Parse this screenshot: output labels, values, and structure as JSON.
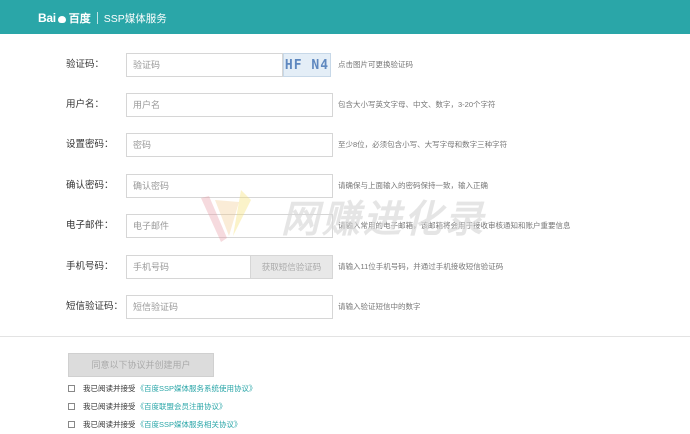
{
  "header": {
    "logo_text": "Bai",
    "logo_cn": "百度",
    "subtitle": "SSP媒体服务",
    "bg_color": "#2aa6a8"
  },
  "form": {
    "captcha": {
      "label": "验证码：",
      "placeholder": "验证码",
      "image_text": "HF N4",
      "hint": "点击图片可更换验证码"
    },
    "username": {
      "label": "用户名：",
      "placeholder": "用户名",
      "hint": "包含大小写英文字母、中文、数字，3-20个字符"
    },
    "password": {
      "label": "设置密码：",
      "placeholder": "密码",
      "hint": "至少8位，必须包含小写、大写字母和数字三种字符"
    },
    "confirm": {
      "label": "确认密码：",
      "placeholder": "确认密码",
      "hint": "请确保与上面输入的密码保持一致，输入正确"
    },
    "email": {
      "label": "电子邮件：",
      "placeholder": "电子邮件",
      "hint": "请输入常用的电子邮箱，该邮箱将会用于接收审核通知和账户重要信息"
    },
    "phone": {
      "label": "手机号码：",
      "placeholder": "手机号码",
      "sms_button": "获取短信验证码",
      "hint": "请输入11位手机号码，并通过手机接收短信验证码"
    },
    "sms_code": {
      "label": "短信验证码：",
      "placeholder": "短信验证码",
      "hint": "请输入验证短信中的数字"
    }
  },
  "submit_label": "同意以下协议并创建用户",
  "agreements": [
    {
      "text": "我已阅读并接受",
      "link": "《百度SSP媒体服务系统使用协议》"
    },
    {
      "text": "我已阅读并接受",
      "link": "《百度联盟会员注册协议》"
    },
    {
      "text": "我已阅读并接受",
      "link": "《百度SSP媒体服务相关协议》"
    }
  ],
  "watermark_text": "网赚进化录",
  "accent_color": "#2aa6a8"
}
